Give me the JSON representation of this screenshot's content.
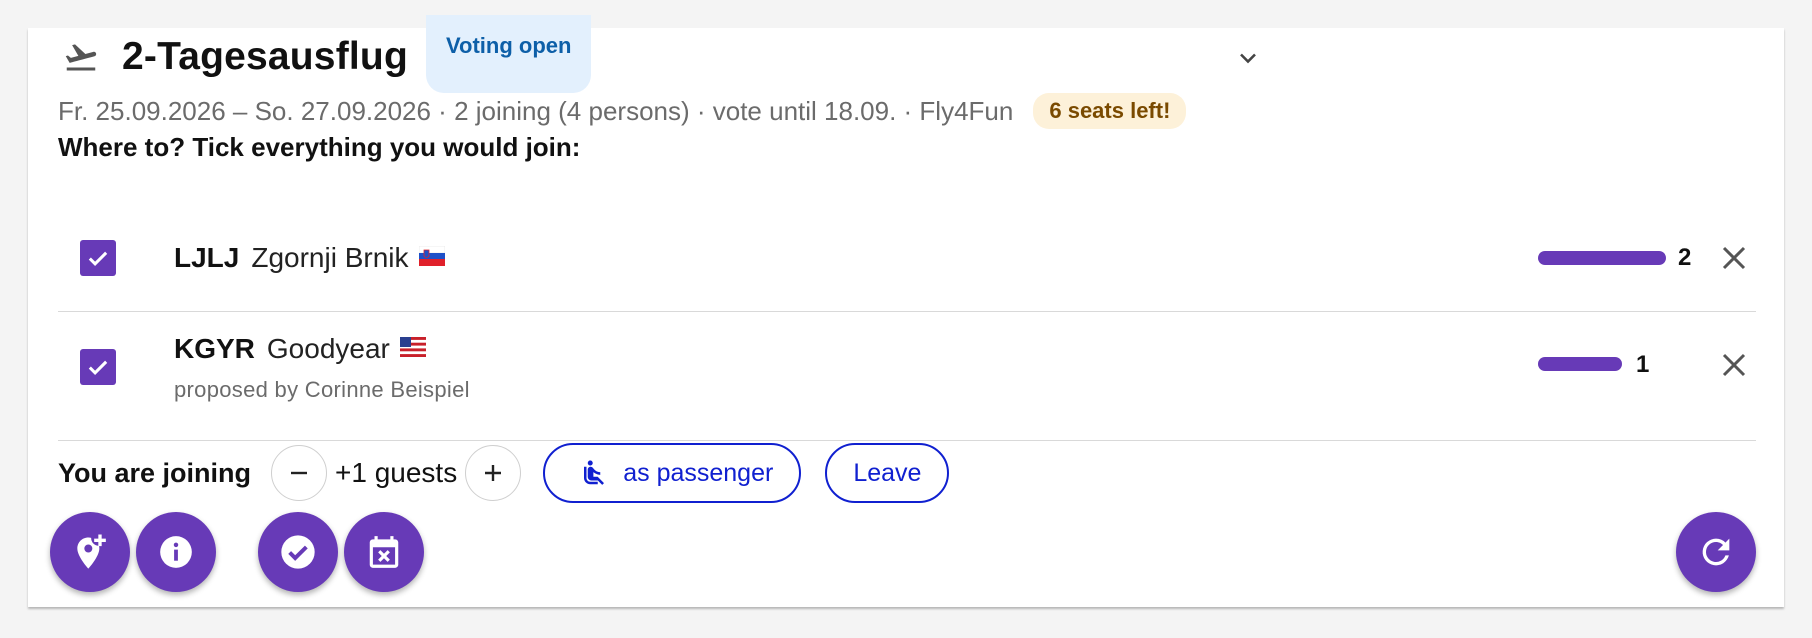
{
  "trip": {
    "title": "2-Tagesausflug",
    "status_badge": "Voting open",
    "details": "Fr. 25.09.2026 – So. 27.09.2026 · 2 joining (4 persons) · vote until 18.09. · Fly4Fun",
    "seats_badge": "6 seats left!"
  },
  "question": "Where to? Tick everything you would join:",
  "destinations": [
    {
      "code": "LJLJ",
      "name": "Zgornji Brnik",
      "flag_icon": "slovenia-flag-icon",
      "checked": true,
      "votes": "2",
      "proposed_by": ""
    },
    {
      "code": "KGYR",
      "name": "Goodyear",
      "flag_icon": "usa-flag-icon",
      "checked": true,
      "votes": "1",
      "proposed_by": "proposed by Corinne Beispiel"
    }
  ],
  "joining": {
    "label": "You are joining",
    "guests": "+1 guests",
    "role_button": "as passenger",
    "leave_button": "Leave"
  },
  "actions": {
    "add_destination_icon": "add-location-icon",
    "info_icon": "info-icon",
    "confirm_icon": "check-circle-icon",
    "cancel_date_icon": "event-busy-icon",
    "refresh_icon": "refresh-icon"
  },
  "colors": {
    "accent": "#673ab7",
    "link": "#1020d0",
    "voting_badge_bg": "#e3f0fd",
    "voting_badge_text": "#0d5fa8",
    "seats_badge_bg": "#fdf1d9",
    "seats_badge_text": "#7a4a00"
  }
}
